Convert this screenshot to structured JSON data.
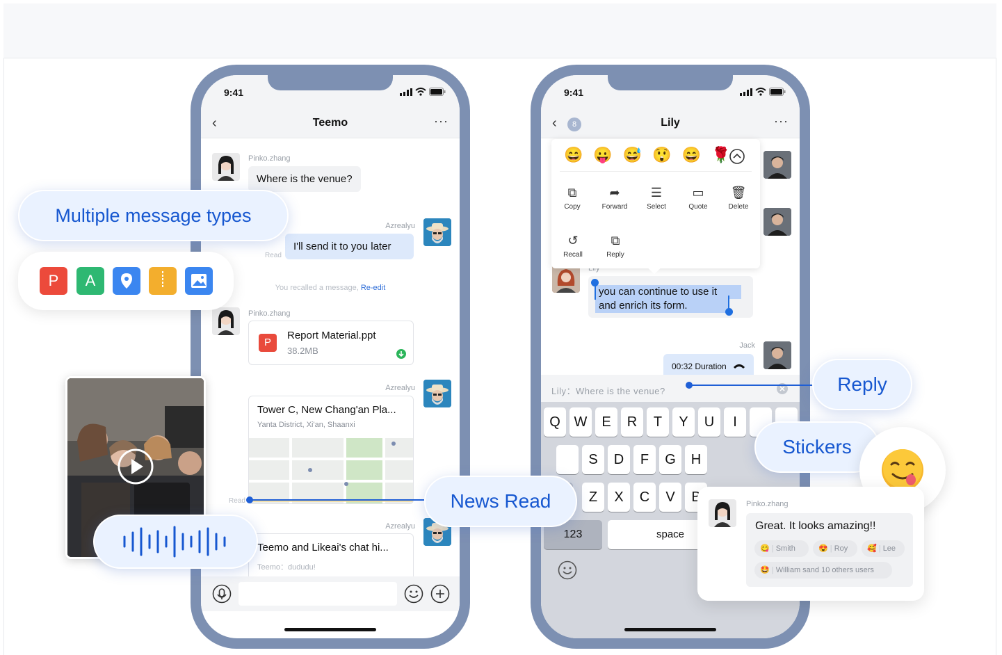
{
  "left_phone": {
    "time": "9:41",
    "title": "Teemo",
    "messages": {
      "m1_name": "Pinko.zhang",
      "m1_text": "Where is the venue?",
      "m2_name": "Azrealyu",
      "m2_text": "I'll send it to you later",
      "m2_read": "Read",
      "recall_text": "You recalled a message,",
      "recall_link": "Re-edit",
      "m3_name": "Pinko.zhang",
      "file_name": "Report Material.ppt",
      "file_size": "38.2MB",
      "file_icon": "P",
      "m4_name": "Azrealyu",
      "loc_title": "Tower C, New Chang'an Pla...",
      "loc_sub": "Yanta District, Xi'an, Shaanxi",
      "m4_read": "Read",
      "m5_name": "Azrealyu",
      "chat_title": "Teemo and Likeai's chat hi...",
      "chat_sub": "Teemo：dududu!"
    }
  },
  "right_phone": {
    "time": "9:41",
    "title": "Lily",
    "unread": "8",
    "emojis": [
      "😄",
      "😛",
      "😅",
      "😲",
      "😄",
      "🌹"
    ],
    "actions": [
      "Copy",
      "Forward",
      "Select",
      "Quote",
      "Delete",
      "Recall",
      "Reply"
    ],
    "sender": "Lily",
    "selected_text_1": "you can continue to use it",
    "selected_text_2": "and enrich its form.",
    "jack_name": "Jack",
    "voice_text": "00:32 Duration",
    "reply_preview": "Lily：Where is the venue?",
    "keyboard_row1": [
      "Q",
      "W",
      "E",
      "R",
      "T",
      "Y",
      "U",
      "I"
    ],
    "keyboard_row2": [
      "S",
      "D",
      "F",
      "G",
      "H"
    ],
    "keyboard_row3": [
      "Z",
      "X",
      "C",
      "V",
      "B"
    ],
    "key_123": "123",
    "key_space": "space"
  },
  "callouts": {
    "multiple": "Multiple message types",
    "app_icons": [
      "P",
      "A"
    ],
    "news_read": "News Read",
    "reply": "Reply",
    "stickers": "Stickers"
  },
  "reaction_card": {
    "name": "Pinko.zhang",
    "text": "Great. It looks amazing!!",
    "reactions": [
      "Smith",
      "Roy",
      "Lee"
    ],
    "summary": "William sand 10 others users"
  },
  "colors": {
    "accent": "#1657d0",
    "phone_frame": "#7d90b2"
  }
}
